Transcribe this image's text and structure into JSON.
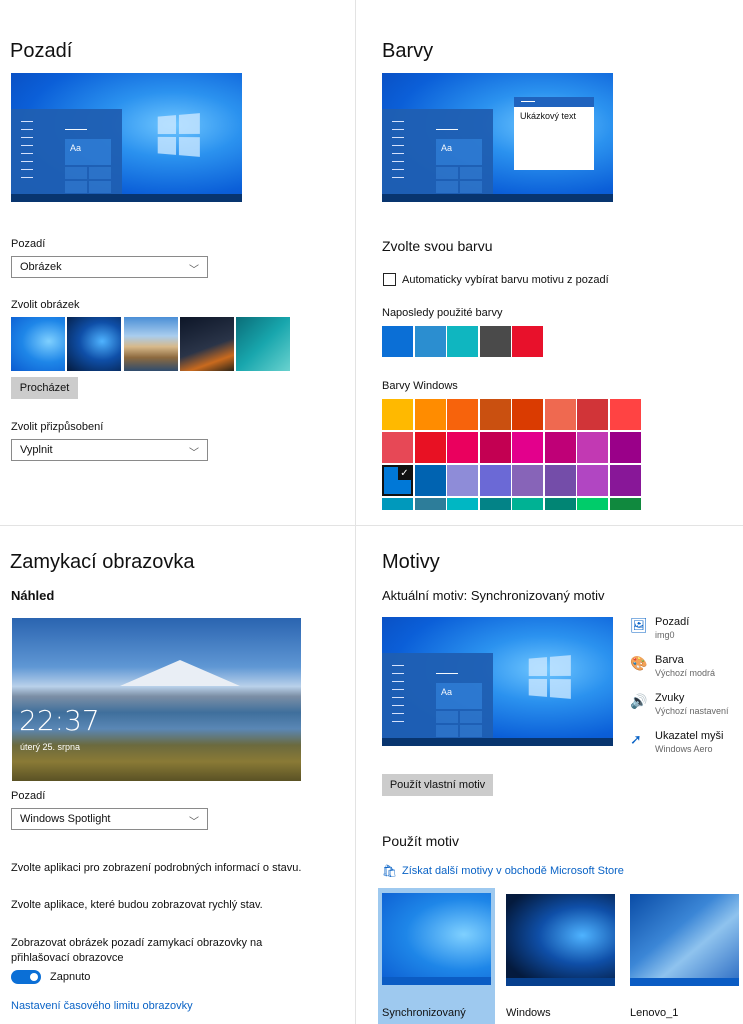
{
  "background": {
    "title": "Pozadí",
    "bg_label": "Pozadí",
    "bg_value": "Obrázek",
    "choose_label": "Zvolit obrázek",
    "browse_button": "Procházet",
    "fit_label": "Zvolit přizpůsobení",
    "fit_value": "Vyplnit"
  },
  "colors": {
    "title": "Barvy",
    "sample_text": "Ukázkový text",
    "choose_title": "Zvolte svou barvu",
    "auto_checkbox": "Automaticky vybírat barvu motivu z pozadí",
    "recent_label": "Naposledy použité barvy",
    "recent": [
      "#0b6fd6",
      "#2b8ed0",
      "#0fb6c0",
      "#4a4a4a",
      "#e8112b"
    ],
    "windows_label": "Barvy Windows",
    "windows_colors": [
      [
        "#ffb900",
        "#ff8c00",
        "#f7630c",
        "#ca5010",
        "#da3b01",
        "#ef6950",
        "#d13438",
        "#ff4343"
      ],
      [
        "#e74856",
        "#e81123",
        "#ea005e",
        "#c30052",
        "#e3008c",
        "#bf0077",
        "#c239b3",
        "#9a0089"
      ],
      [
        "#0078d7",
        "#0063b1",
        "#8e8cd8",
        "#6b69d6",
        "#8764b8",
        "#744da9",
        "#b146c2",
        "#881798"
      ],
      [
        "#0099bc",
        "#2d7d9a",
        "#00b7c3",
        "#038387",
        "#00b294",
        "#018574",
        "#00cc6a",
        "#10893e"
      ]
    ]
  },
  "lock": {
    "title": "Zamykací obrazovka",
    "preview_label": "Náhled",
    "time": "22:37",
    "date": "úterý 25. srpna",
    "bg_label": "Pozadí",
    "bg_value": "Windows Spotlight",
    "detail_app": "Zvolte aplikaci pro zobrazení podrobných informací o stavu.",
    "quick_apps": "Zvolte aplikace, které budou zobrazovat rychlý stav.",
    "signin_bg": "Zobrazovat obrázek pozadí zamykací obrazovky na přihlašovací obrazovce",
    "toggle_state": "Zapnuto",
    "timeout_link": "Nastavení časového limitu obrazovky"
  },
  "themes": {
    "title": "Motivy",
    "current": "Aktuální motiv: Synchronizovaný motiv",
    "items": [
      {
        "label": "Pozadí",
        "sub": "img0",
        "icon": "picture-icon"
      },
      {
        "label": "Barva",
        "sub": "Výchozí modrá",
        "icon": "palette-icon"
      },
      {
        "label": "Zvuky",
        "sub": "Výchozí nastavení",
        "icon": "speaker-icon"
      },
      {
        "label": "Ukazatel myši",
        "sub": "Windows Aero",
        "icon": "cursor-icon"
      }
    ],
    "save_button": "Použít vlastní motiv",
    "apply_title": "Použít motiv",
    "store_link": "Získat další motivy v obchodě Microsoft Store",
    "theme_list": [
      "Synchronizovaný",
      "Windows",
      "Lenovo_1"
    ],
    "accent": "#0b6fd6"
  }
}
